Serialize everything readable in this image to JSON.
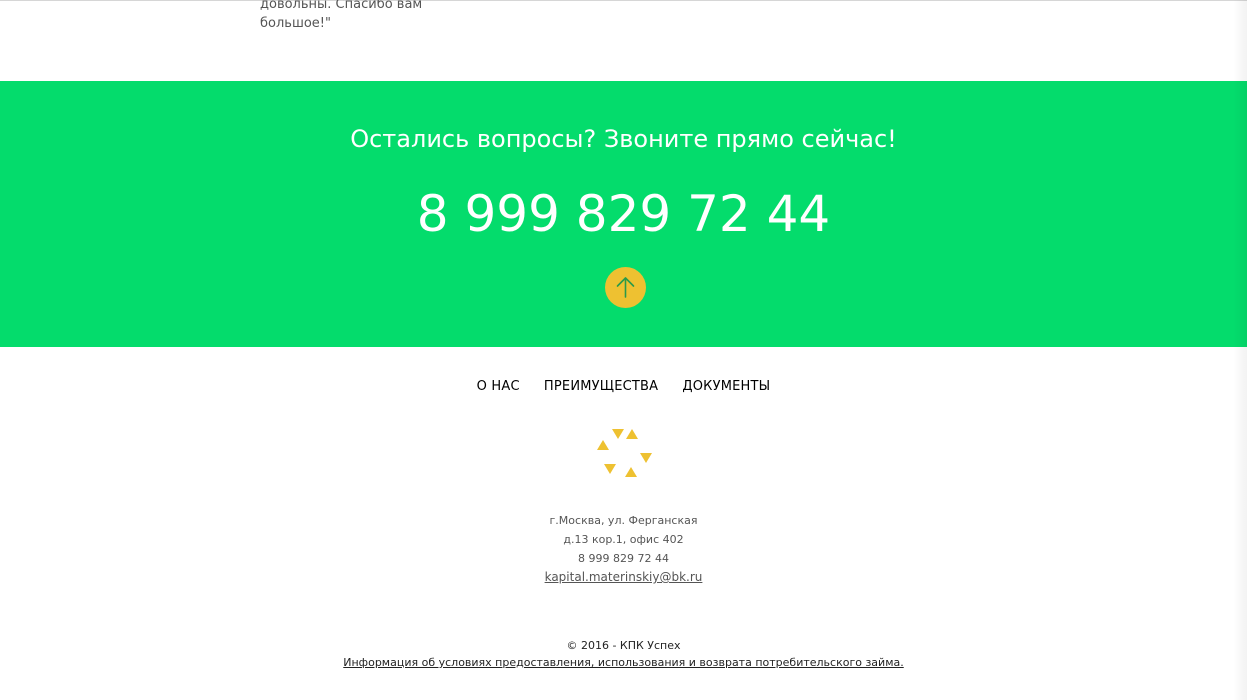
{
  "testimonial": {
    "line1": "довольны. Спасибо вам",
    "line2": "большое!\""
  },
  "cta": {
    "title": "Остались вопросы? Звоните прямо сейчас!",
    "phone": "8 999 829 72 44",
    "up_icon": "arrow-up-icon",
    "background_color": "#04dc6c",
    "button_color": "#eec131"
  },
  "nav": {
    "items": [
      {
        "label": "О НАС"
      },
      {
        "label": "ПРЕИМУЩЕСТВА"
      },
      {
        "label": "ДОКУМЕНТЫ"
      }
    ]
  },
  "logo": {
    "icon": "triangles-logo-icon",
    "color": "#eec131"
  },
  "contacts": {
    "address_line1": "г.Москва, ул. Ферганская",
    "address_line2": "д.13 кор.1, офис 402",
    "phone": "8 999 829 72 44",
    "email": "kapital.materinskiy@bk.ru"
  },
  "footer": {
    "copyright": "© 2016 - КПК Успех",
    "info_link": "Информация об условиях предоставления, использования и возврата потребительского займа."
  }
}
